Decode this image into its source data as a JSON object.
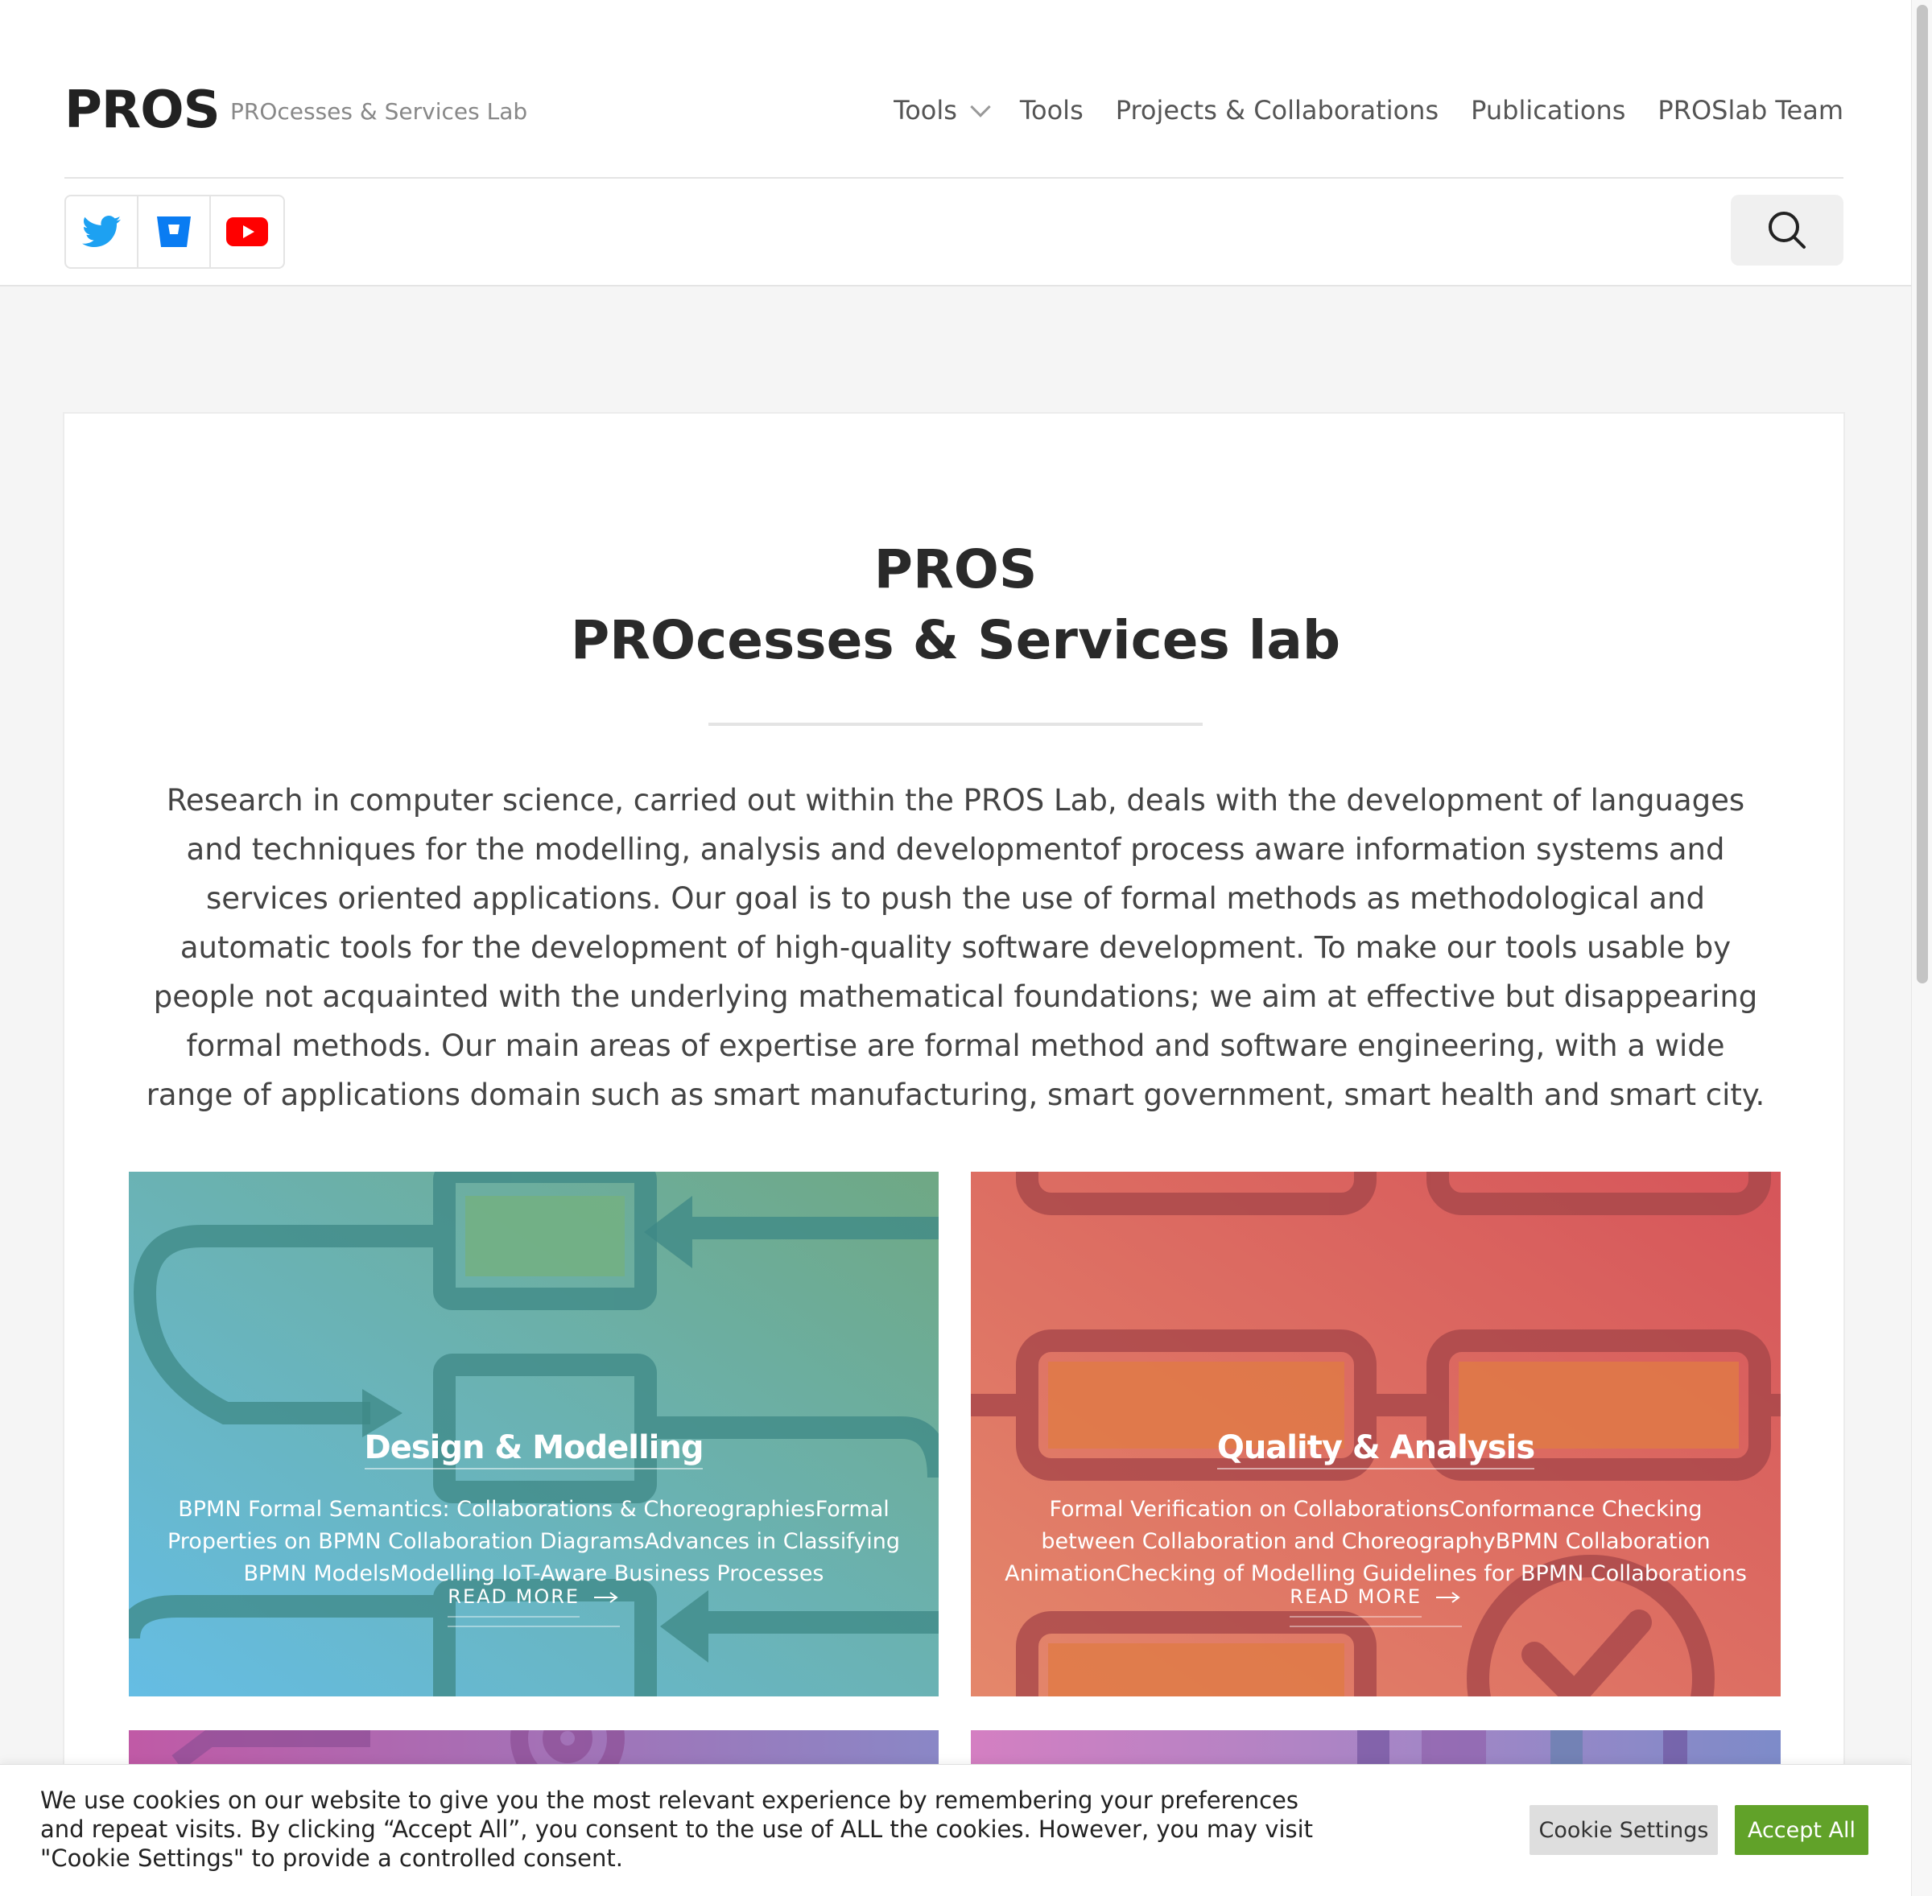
{
  "header": {
    "brand": "PROS",
    "tagline": "PROcesses & Services Lab",
    "nav": [
      {
        "label": "Tools",
        "has_dropdown": true
      },
      {
        "label": "Tools"
      },
      {
        "label": "Projects & Collaborations"
      },
      {
        "label": "Publications"
      },
      {
        "label": "PROSlab Team"
      }
    ],
    "social": [
      {
        "icon": "twitter-icon",
        "color": "#1DA1F2"
      },
      {
        "icon": "bitbucket-icon",
        "color": "#0A7CF2"
      },
      {
        "icon": "youtube-icon",
        "color": "#FF0000"
      }
    ],
    "search_icon": "search-icon"
  },
  "hero": {
    "title_line1": "PROS",
    "title_line2": "PROcesses & Services lab",
    "intro": "Research in computer science, carried out within the PROS Lab, deals with the development of languages and techniques for the modelling, analysis and developmentof process aware information systems and services oriented applications. Our goal is to push the use of formal methods as methodological and automatic tools for the development of high-quality software development. To make our tools usable by people not acquainted with the underlying mathematical foundations; we aim at effective but disappearing formal methods. Our main areas of expertise are formal method and software engineering, with a wide range of applications domain such as smart manufacturing, smart government, smart health and smart city."
  },
  "tiles": [
    {
      "title": "Design & Modelling",
      "description": "BPMN Formal Semantics: Collaborations & ChoreographiesFormal Properties on BPMN Collaboration DiagramsAdvances in Classifying BPMN ModelsModelling IoT-Aware Business Processes",
      "read_more": "READ MORE",
      "colors": [
        "#65bde4",
        "#6fa884"
      ]
    },
    {
      "title": "Quality & Analysis",
      "description": "Formal Verification on CollaborationsConformance Checking between Collaboration and ChoreographyBPMN Collaboration AnimationChecking of Modelling Guidelines for BPMN Collaborations",
      "read_more": "READ MORE",
      "colors": [
        "#e4876b",
        "#d6555a"
      ]
    }
  ],
  "cookie": {
    "text": "We use cookies on our website to give you the most relevant experience by remembering your preferences and repeat visits. By clicking “Accept All”, you consent to the use of ALL the cookies. However, you may visit \"Cookie Settings\" to provide a controlled consent.",
    "settings_label": "Cookie Settings",
    "accept_label": "Accept All",
    "accept_color": "#61a229"
  }
}
